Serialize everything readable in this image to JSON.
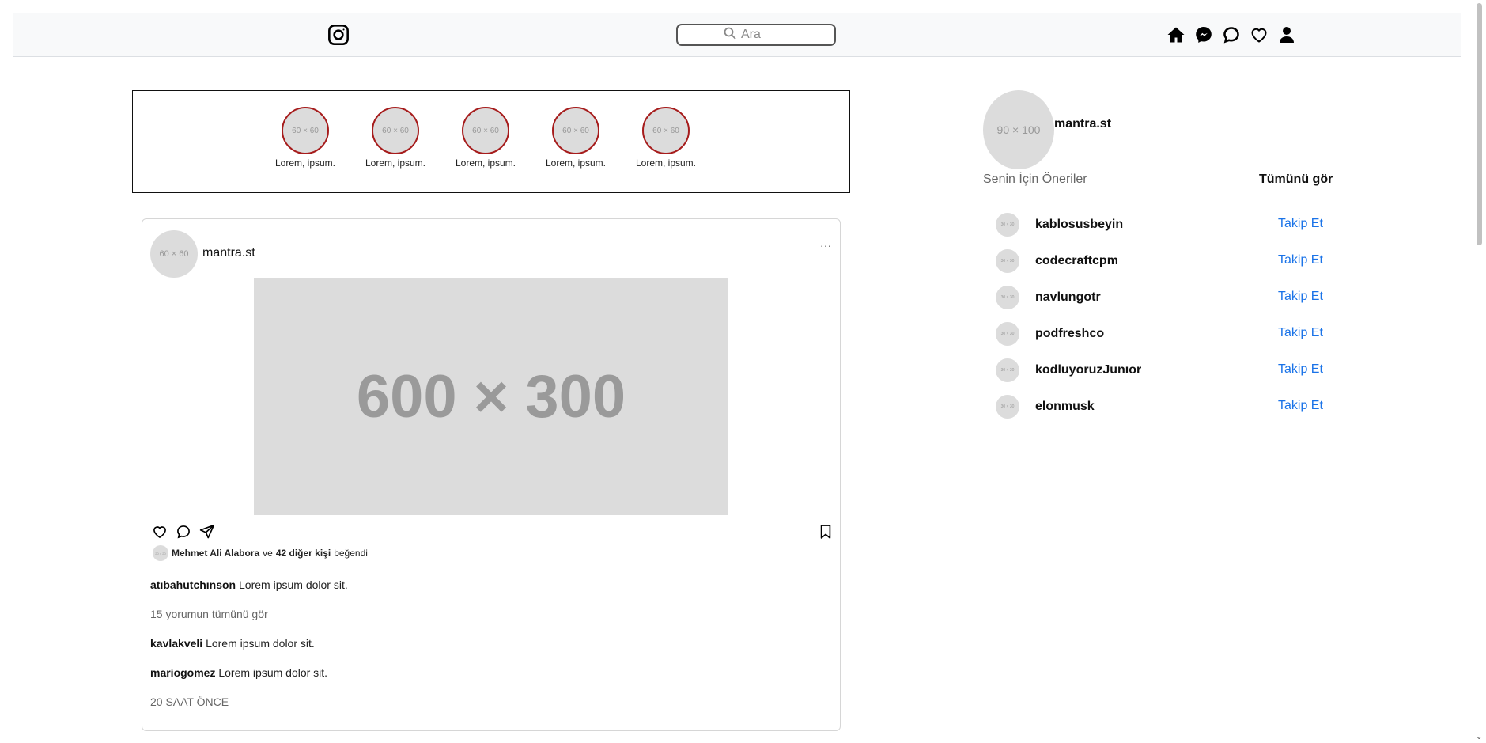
{
  "navbar": {
    "search_placeholder": "Ara",
    "icons": [
      "instagram-icon",
      "search-icon",
      "home-icon",
      "messenger-icon",
      "chat-icon",
      "heart-icon",
      "user-icon"
    ]
  },
  "stories": [
    {
      "avatar": "60 × 60",
      "label": "Lorem, ipsum."
    },
    {
      "avatar": "60 × 60",
      "label": "Lorem, ipsum."
    },
    {
      "avatar": "60 × 60",
      "label": "Lorem, ipsum."
    },
    {
      "avatar": "60 × 60",
      "label": "Lorem, ipsum."
    },
    {
      "avatar": "60 × 60",
      "label": "Lorem, ipsum."
    }
  ],
  "post": {
    "avatar": "60 × 60",
    "username": "mantra.st",
    "more": "...",
    "image": "600 × 300",
    "likes": {
      "avatar": "20 × 20",
      "user": "Mehmet Ali Alabora",
      "ve": "ve",
      "others": "42 diğer kişi",
      "suffix": "beğendi"
    },
    "caption": {
      "user": "atıbahutchınson",
      "text": "Lorem ipsum dolor sit."
    },
    "view_all": "15 yorumun tümünü gör",
    "comments": [
      {
        "user": "kavlakveli",
        "text": "Lorem ipsum dolor sit."
      },
      {
        "user": "mariogomez",
        "text": "Lorem ipsum dolor sit."
      }
    ],
    "time": "20 SAAT ÖNCE"
  },
  "sidebar": {
    "avatar": "90 × 100",
    "username": "mantra.st",
    "suggestions_title": "Senin İçin Öneriler",
    "see_all": "Tümünü gör",
    "suggestions": [
      {
        "avatar": "30 × 30",
        "name": "kablosusbeyin",
        "action": "Takip Et"
      },
      {
        "avatar": "30 × 30",
        "name": "codecraftcpm",
        "action": "Takip Et"
      },
      {
        "avatar": "30 × 30",
        "name": "navlungotr",
        "action": "Takip Et"
      },
      {
        "avatar": "30 × 30",
        "name": "podfreshco",
        "action": "Takip Et"
      },
      {
        "avatar": "30 × 30",
        "name": "kodluyoruzJunıor",
        "action": "Takip Et"
      },
      {
        "avatar": "30 × 30",
        "name": "elonmusk",
        "action": "Takip Et"
      }
    ]
  }
}
